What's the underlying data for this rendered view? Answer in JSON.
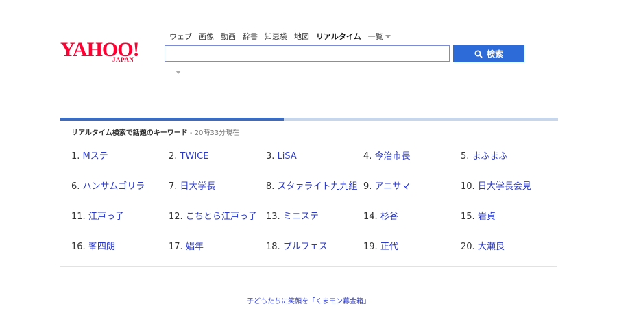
{
  "logo": {
    "main": "YAHOO!",
    "sub": "JAPAN"
  },
  "nav": {
    "tabs": [
      {
        "label": "ウェブ",
        "active": false
      },
      {
        "label": "画像",
        "active": false
      },
      {
        "label": "動画",
        "active": false
      },
      {
        "label": "辞書",
        "active": false
      },
      {
        "label": "知恵袋",
        "active": false
      },
      {
        "label": "地図",
        "active": false
      },
      {
        "label": "リアルタイム",
        "active": true
      }
    ],
    "more_label": "一覧"
  },
  "search": {
    "value": "",
    "button_label": "検索"
  },
  "trends": {
    "title": "リアルタイム検索で話題のキーワード",
    "time": " - 20時33分現在",
    "progress_fraction": 0.45,
    "items": [
      {
        "num": "1.",
        "kw": "Mステ"
      },
      {
        "num": "2.",
        "kw": "TWICE"
      },
      {
        "num": "3.",
        "kw": "LiSA"
      },
      {
        "num": "4.",
        "kw": "今治市長"
      },
      {
        "num": "5.",
        "kw": "まふまふ"
      },
      {
        "num": "6.",
        "kw": "ハンサムゴリラ"
      },
      {
        "num": "7.",
        "kw": "日大学長"
      },
      {
        "num": "8.",
        "kw": "スタァライト九九組"
      },
      {
        "num": "9.",
        "kw": "アニサマ"
      },
      {
        "num": "10.",
        "kw": "日大学長会見"
      },
      {
        "num": "11.",
        "kw": "江戸っ子"
      },
      {
        "num": "12.",
        "kw": "こちとら江戸っ子"
      },
      {
        "num": "13.",
        "kw": "ミニステ"
      },
      {
        "num": "14.",
        "kw": "杉谷"
      },
      {
        "num": "15.",
        "kw": "岩貞"
      },
      {
        "num": "16.",
        "kw": "峯四朗"
      },
      {
        "num": "17.",
        "kw": "娼年"
      },
      {
        "num": "18.",
        "kw": "ブルフェス"
      },
      {
        "num": "19.",
        "kw": "正代"
      },
      {
        "num": "20.",
        "kw": "大瀬良"
      }
    ]
  },
  "footer": {
    "link": "子どもたちに笑顔を「くまモン募金箱」"
  }
}
